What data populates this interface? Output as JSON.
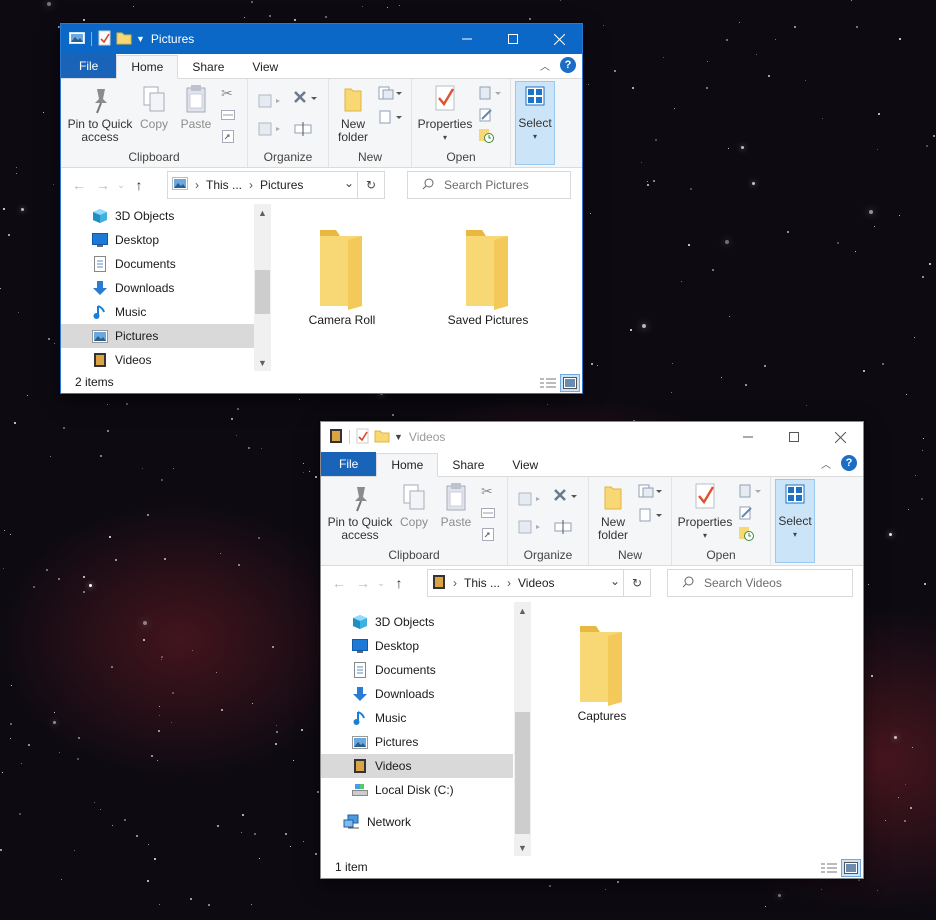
{
  "pictures_window": {
    "title": "Pictures",
    "tabs": [
      "File",
      "Home",
      "Share",
      "View"
    ],
    "ribbon": {
      "pin_label_1": "Pin to Quick",
      "pin_label_2": "access",
      "copy_label": "Copy",
      "paste_label": "Paste",
      "clipboard_group": "Clipboard",
      "organize_group": "Organize",
      "new_folder_label_1": "New",
      "new_folder_label_2": "folder",
      "new_group": "New",
      "properties_label": "Properties",
      "open_group": "Open",
      "select_label": "Select"
    },
    "address": {
      "crumb1": "This ...",
      "crumb2": "Pictures"
    },
    "search_placeholder": "Search Pictures",
    "nav_items": [
      {
        "label": "3D Objects"
      },
      {
        "label": "Desktop"
      },
      {
        "label": "Documents"
      },
      {
        "label": "Downloads"
      },
      {
        "label": "Music"
      },
      {
        "label": "Pictures"
      },
      {
        "label": "Videos"
      }
    ],
    "files": [
      {
        "name": "Camera Roll"
      },
      {
        "name": "Saved Pictures"
      }
    ],
    "status": "2 items"
  },
  "videos_window": {
    "title": "Videos",
    "tabs": [
      "File",
      "Home",
      "Share",
      "View"
    ],
    "ribbon": {
      "pin_label_1": "Pin to Quick",
      "pin_label_2": "access",
      "copy_label": "Copy",
      "paste_label": "Paste",
      "clipboard_group": "Clipboard",
      "organize_group": "Organize",
      "new_folder_label_1": "New",
      "new_folder_label_2": "folder",
      "new_group": "New",
      "properties_label": "Properties",
      "open_group": "Open",
      "select_label": "Select"
    },
    "address": {
      "crumb1": "This ...",
      "crumb2": "Videos"
    },
    "search_placeholder": "Search Videos",
    "nav_items": [
      {
        "label": "3D Objects"
      },
      {
        "label": "Desktop"
      },
      {
        "label": "Documents"
      },
      {
        "label": "Downloads"
      },
      {
        "label": "Music"
      },
      {
        "label": "Pictures"
      },
      {
        "label": "Videos"
      },
      {
        "label": "Local Disk (C:)"
      }
    ],
    "network_label": "Network",
    "files": [
      {
        "name": "Captures"
      }
    ],
    "status": "1 item"
  },
  "colors": {
    "accent": "#0b68c7",
    "file_tab": "#1964b8",
    "folder": "#f8d775",
    "selection": "#cce4f7"
  }
}
